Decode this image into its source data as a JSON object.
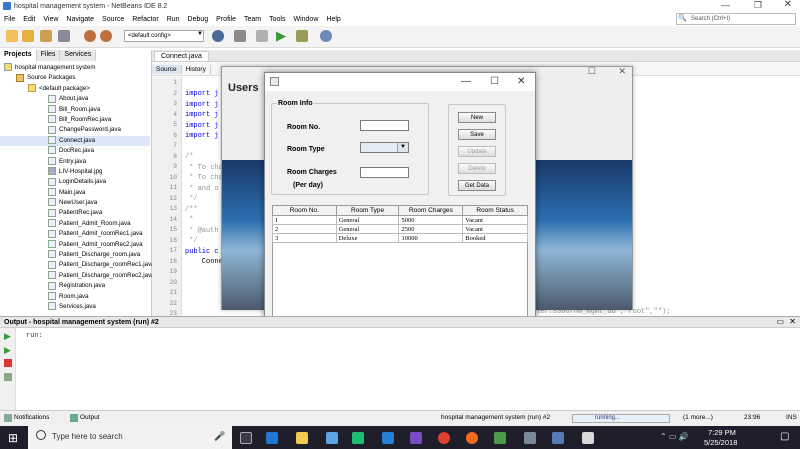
{
  "window": {
    "title": "hospital management system - NetBeans IDE 8.2"
  },
  "menu": [
    "File",
    "Edit",
    "View",
    "Navigate",
    "Source",
    "Refactor",
    "Run",
    "Debug",
    "Profile",
    "Team",
    "Tools",
    "Window",
    "Help"
  ],
  "search": {
    "placeholder": "Search (Ctrl+I)"
  },
  "toolbar": {
    "config": "<default config>"
  },
  "projects": {
    "tabs": [
      "Projects",
      "Files",
      "Services"
    ],
    "root": "hospital management system",
    "source_packages": "Source Packages",
    "default_package": "<default package>",
    "files": [
      "About.java",
      "Bill_Room.java",
      "Bill_RoomRec.java",
      "ChangePassword.java",
      "Connect.java",
      "DocRec.java",
      "Entry.java",
      "LIV-Hospital.jpg",
      "LoginDetails.java",
      "Main.java",
      "NewUser.java",
      "PatientRec.java",
      "Patient_Admit_Room.java",
      "Patient_Admit_roomRec1.java",
      "Patient_Admit_roomRec2.java",
      "Patient_Discharge_room.java",
      "Patient_Discharge_roomRec1.java",
      "Patient_Discharge_roomRec2.java",
      "Registration.java",
      "Room.java",
      "Services.java"
    ]
  },
  "editor": {
    "tab": "Connect.java",
    "modes": [
      "Source",
      "History"
    ],
    "lines": [
      "1",
      "2",
      "3",
      "4",
      "5",
      "6",
      "7",
      "8",
      "9",
      "10",
      "11",
      "12",
      "13",
      "14",
      "15",
      "16",
      "17",
      "18",
      "19",
      "20",
      "21",
      "22",
      "23"
    ],
    "code": {
      "import": "import j",
      "c1": "/*",
      "c2": " * To cha",
      "c3": " * To cha",
      "c4": " * and o",
      "c5": " */",
      "c6": "/**",
      "c7": " *",
      "c8": " * @auth",
      "c9": " */",
      "c10": "public c",
      "c11": "    Conne",
      "tail": "ler:3306/hm_mgmt_db\",\"root\",\"\");"
    }
  },
  "users_window": {
    "title": "Users"
  },
  "dialog": {
    "group_title": "Room Info",
    "room_no_label": "Room No.",
    "room_type_label": "Room Type",
    "room_charges_label": "Room Charges",
    "per_day_label": "(Per day)",
    "room_no_value": "",
    "room_charges_value": "",
    "buttons": {
      "new": "New",
      "save": "Save",
      "update": "Update",
      "delete": "Delete",
      "get_data": "Get Data"
    },
    "table": {
      "columns": [
        "Room No.",
        "Room Type",
        "Room Charges",
        "Room Status"
      ],
      "rows": [
        [
          "1",
          "General",
          "5000",
          "Vacant"
        ],
        [
          "2",
          "General",
          "2500",
          "Vacant"
        ],
        [
          "3",
          "Deluxe",
          "10000",
          "Booked"
        ]
      ]
    }
  },
  "output": {
    "title": "Output - hospital management system (run) #2",
    "text": "run:"
  },
  "status": {
    "notifications": "Notifications",
    "output": "Output",
    "run_label": "hospital management system (run) #2",
    "running": "running...",
    "more": "(1 more...)",
    "position": "23:96",
    "mode": "INS"
  },
  "taskbar": {
    "search_placeholder": "Type here to search",
    "time": "7:29 PM",
    "date": "5/25/2018"
  }
}
